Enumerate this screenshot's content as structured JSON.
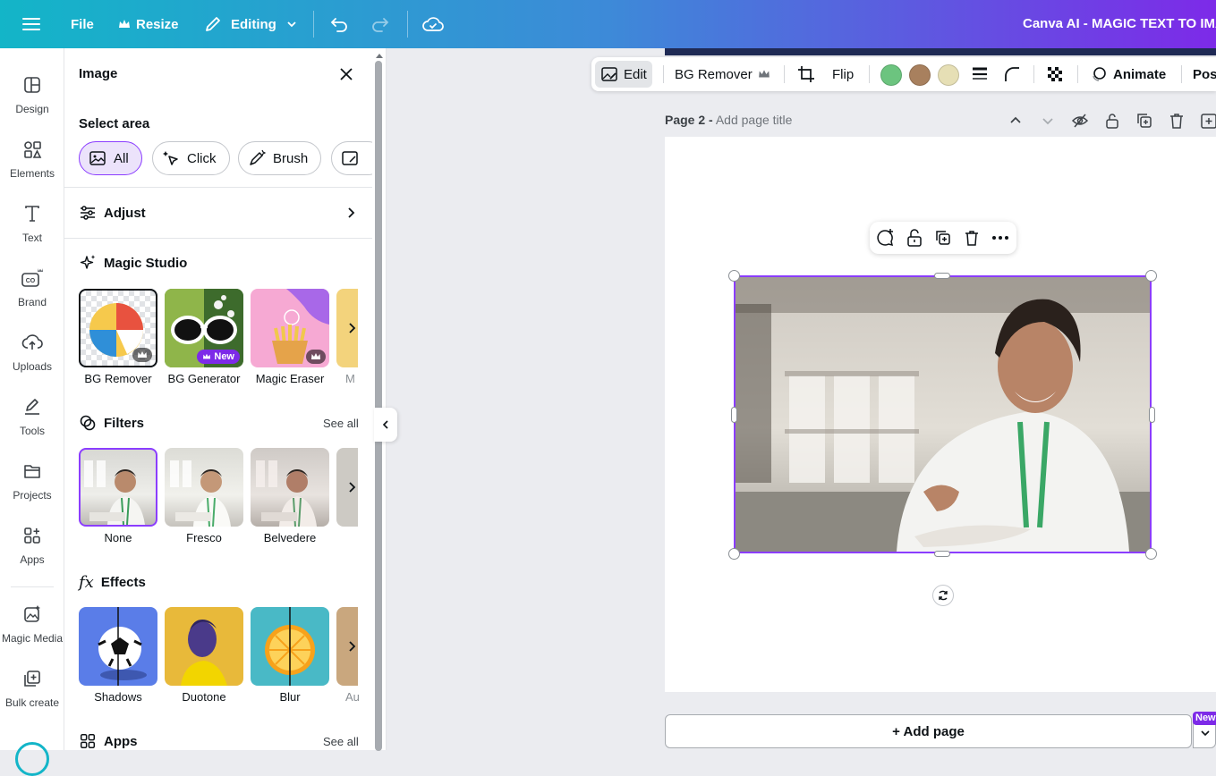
{
  "topbar": {
    "file_label": "File",
    "resize_label": "Resize",
    "editing_label": "Editing",
    "doc_title": "Canva AI - MAGIC TEXT TO IMAG"
  },
  "rail": {
    "items": [
      {
        "label": "Design"
      },
      {
        "label": "Elements"
      },
      {
        "label": "Text"
      },
      {
        "label": "Brand"
      },
      {
        "label": "Uploads"
      },
      {
        "label": "Tools"
      },
      {
        "label": "Projects"
      },
      {
        "label": "Apps"
      },
      {
        "label": "Magic Media"
      },
      {
        "label": "Bulk create"
      }
    ]
  },
  "panel": {
    "title": "Image",
    "select_area": {
      "title": "Select area",
      "chips": [
        {
          "label": "All"
        },
        {
          "label": "Click"
        },
        {
          "label": "Brush"
        }
      ]
    },
    "adjust": {
      "title": "Adjust"
    },
    "magic_studio": {
      "title": "Magic Studio",
      "items": [
        {
          "label": "BG Remover"
        },
        {
          "label": "BG Generator",
          "badge": "New"
        },
        {
          "label": "Magic Eraser"
        },
        {
          "label": "M"
        }
      ]
    },
    "filters": {
      "title": "Filters",
      "see_all": "See all",
      "items": [
        {
          "label": "None"
        },
        {
          "label": "Fresco"
        },
        {
          "label": "Belvedere"
        }
      ]
    },
    "effects": {
      "title": "Effects",
      "icon_text": "fx",
      "items": [
        {
          "label": "Shadows"
        },
        {
          "label": "Duotone"
        },
        {
          "label": "Blur"
        },
        {
          "label": "Au"
        }
      ]
    },
    "apps": {
      "title": "Apps",
      "see_all": "See all"
    }
  },
  "ctx_toolbar": {
    "edit_label": "Edit",
    "bg_remover_label": "BG Remover",
    "flip_label": "Flip",
    "animate_label": "Animate",
    "position_label": "Posi",
    "swatches": [
      "#6cc47f",
      "#a8805e",
      "#e6dfb5"
    ]
  },
  "page": {
    "prefix": "Page 2 -",
    "title_placeholder": "Add page title"
  },
  "add_page": {
    "label": "+ Add page",
    "new_badge": "New"
  },
  "colors": {
    "accent": "#8b3dff",
    "topbar_start": "#13b5c8",
    "topbar_end": "#7d2ae8"
  }
}
